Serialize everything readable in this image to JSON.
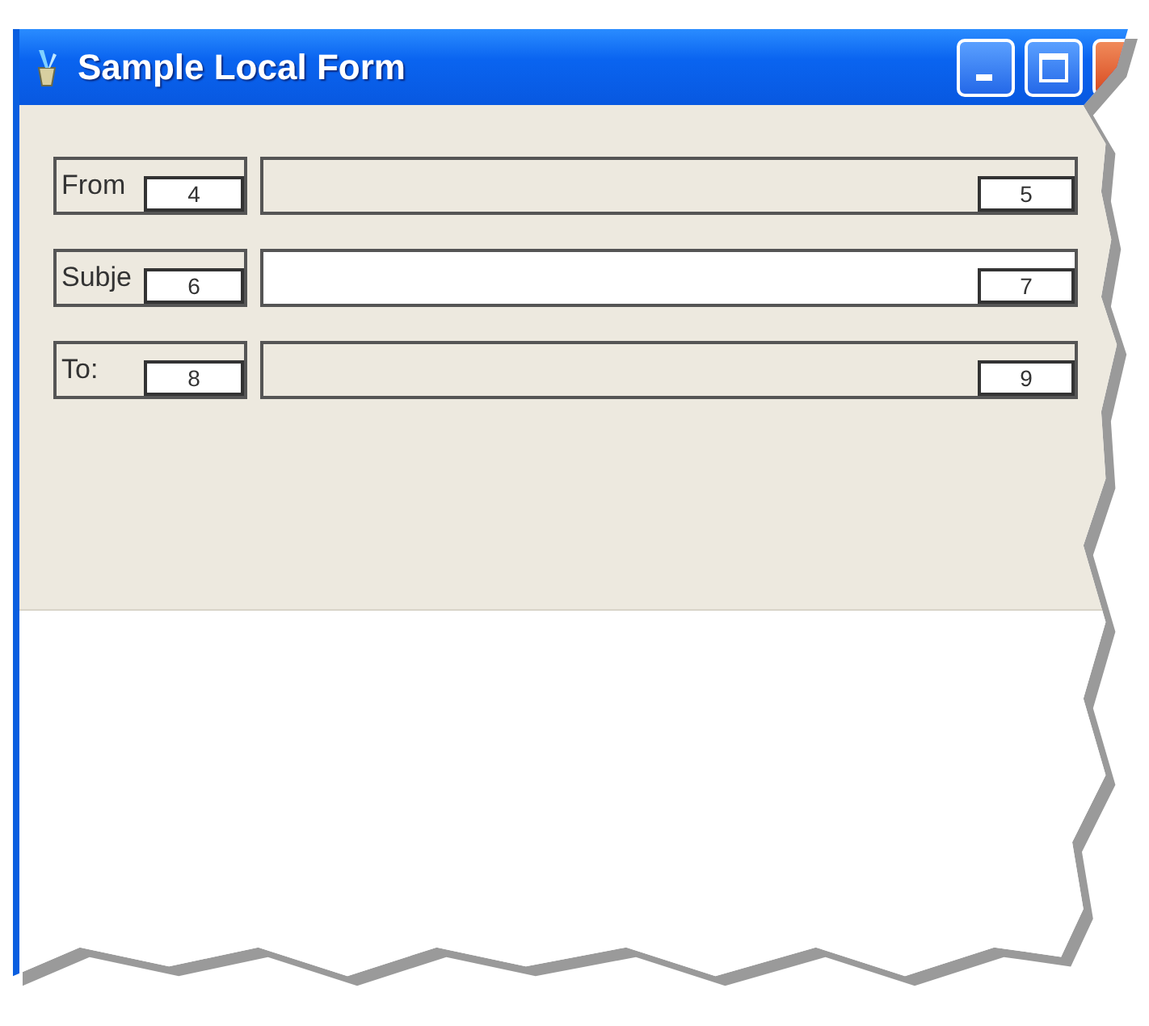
{
  "window": {
    "title": "Sample Local Form",
    "buttons": [
      {
        "kind": "minimize"
      },
      {
        "kind": "maximize"
      },
      {
        "kind": "close"
      }
    ]
  },
  "rows": [
    {
      "label": "From",
      "label_badge": "4",
      "field_badge": "5",
      "disabled": true
    },
    {
      "label": "Subje",
      "label_badge": "6",
      "field_badge": "7",
      "disabled": false
    },
    {
      "label": "To:",
      "label_badge": "8",
      "field_badge": "9",
      "disabled": true
    }
  ]
}
